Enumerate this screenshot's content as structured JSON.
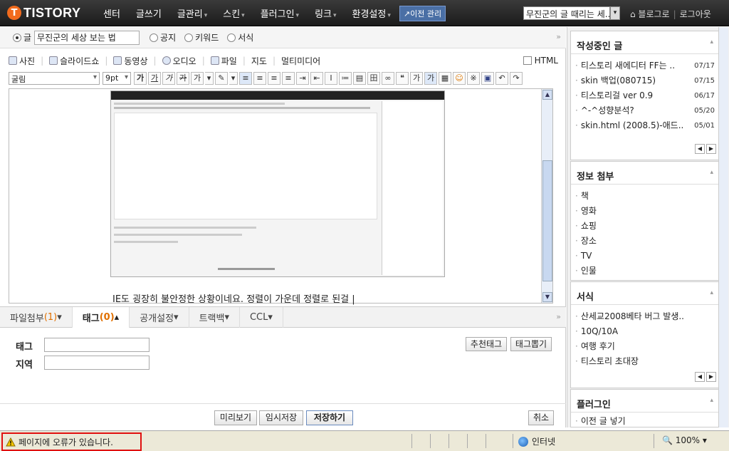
{
  "topnav": {
    "logo": "TISTORY",
    "logo_mark": "T",
    "menu": [
      {
        "label": "센터",
        "dropdown": false
      },
      {
        "label": "글쓰기",
        "dropdown": false
      },
      {
        "label": "글관리",
        "dropdown": true
      },
      {
        "label": "스킨",
        "dropdown": true
      },
      {
        "label": "플러그인",
        "dropdown": true
      },
      {
        "label": "링크",
        "dropdown": true
      },
      {
        "label": "환경설정",
        "dropdown": true
      }
    ],
    "prev_manager": "↗이전 관리",
    "blog_select": "무진군의 글 때리는 세..",
    "to_blog": "⌂ 블로그로",
    "logout": "로그아웃"
  },
  "editor": {
    "type_label": "글",
    "title_value": "무진군의 세상 보는 법",
    "options": [
      "공지",
      "키워드",
      "서식"
    ],
    "collapse": "»",
    "media": [
      "사진",
      "슬라이드쇼",
      "동영상",
      "오디오",
      "파일",
      "지도",
      "멀티미디어"
    ],
    "html_label": "HTML",
    "font": "굴림",
    "size": "9pt",
    "buttons": [
      "가",
      "가",
      "가",
      "가",
      "가",
      "A",
      "✎",
      "≡",
      "≡",
      "≡",
      "≡",
      "⇥",
      "⇤",
      "I",
      "≔",
      "▤",
      "田",
      "∞",
      "❝",
      "가",
      "가",
      "▦",
      "☺",
      "※",
      "▣",
      "↶",
      "↷"
    ],
    "body_text": "IE도 굉장히 불안정한 상황이네요. 정렬이 가운데 정렬로 된걸 |"
  },
  "tabs": [
    {
      "label": "파일첨부",
      "count": "(1)",
      "arrow": "▾",
      "active": false
    },
    {
      "label": "태그",
      "count": "(0)",
      "arrow": "▴",
      "active": true
    },
    {
      "label": "공개설정",
      "count": "",
      "arrow": "▾",
      "active": false
    },
    {
      "label": "트랙백",
      "count": "",
      "arrow": "▾",
      "active": false
    },
    {
      "label": "CCL",
      "count": "",
      "arrow": "▾",
      "active": false
    }
  ],
  "tags_collapse": "»",
  "tagpanel": {
    "tag_label": "태그",
    "region_label": "지역",
    "recommend_btn": "추천태그",
    "extract_btn": "태그뽑기"
  },
  "actions": {
    "preview": "미리보기",
    "temp_save": "임시저장",
    "save": "저장하기",
    "cancel": "취소"
  },
  "sidebar": {
    "writing": {
      "title": "작성중인 글",
      "items": [
        {
          "text": "티스토리 새에디터 FF는 ..",
          "date": "07/17"
        },
        {
          "text": "skin 백업(080715)",
          "date": "07/15"
        },
        {
          "text": "티스토리걸 ver 0.9",
          "date": "06/17"
        },
        {
          "text": "^-^성향분석?",
          "date": "05/20"
        },
        {
          "text": "skin.html (2008.5)-애드..",
          "date": "05/01"
        }
      ]
    },
    "info": {
      "title": "정보 첨부",
      "items": [
        "책",
        "영화",
        "쇼핑",
        "장소",
        "TV",
        "인물"
      ]
    },
    "format": {
      "title": "서식",
      "items": [
        "산세교2008베타 버그 발생..",
        "10Q/10A",
        "여행 후기",
        "티스토리 초대장"
      ]
    },
    "plugin": {
      "title": "플러그인",
      "items": [
        "이전 글 넣기"
      ]
    }
  },
  "statusbar": {
    "error": "페이지에 오류가 있습니다.",
    "zone": "인터넷",
    "zoom": "100%"
  },
  "colors": {
    "accent": "#f26b1d",
    "error_border": "#e01010",
    "tab_count": "#e07000"
  }
}
